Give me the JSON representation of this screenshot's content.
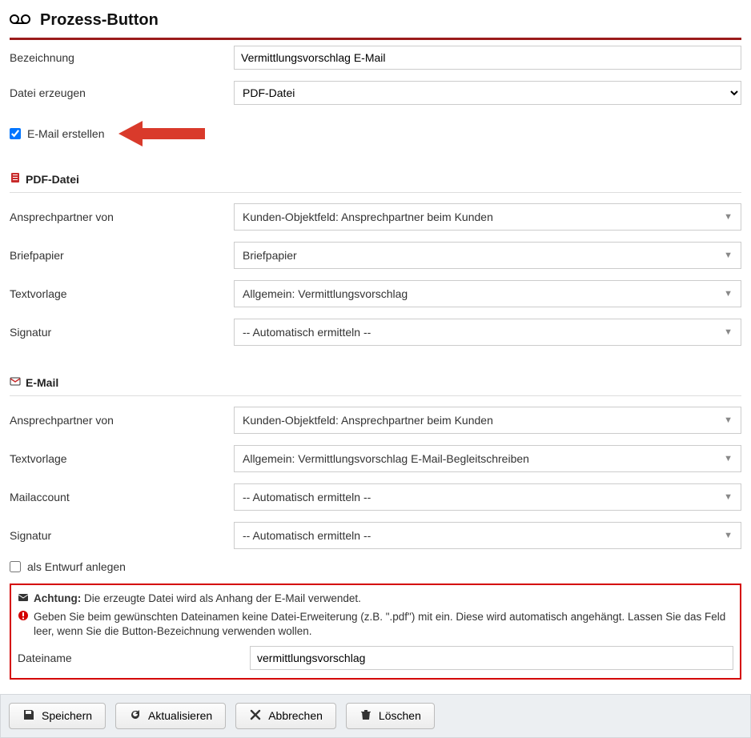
{
  "header": {
    "title": "Prozess-Button"
  },
  "form": {
    "bezeichnung_label": "Bezeichnung",
    "bezeichnung_value": "Vermittlungsvorschlag E-Mail",
    "datei_erzeugen_label": "Datei erzeugen",
    "datei_erzeugen_value": "PDF-Datei",
    "email_erstellen_label": "E-Mail erstellen"
  },
  "pdf_section": {
    "title": "PDF-Datei",
    "ansprechpartner_label": "Ansprechpartner von",
    "ansprechpartner_value": "Kunden-Objektfeld: Ansprechpartner beim Kunden",
    "briefpapier_label": "Briefpapier",
    "briefpapier_value": "Briefpapier",
    "textvorlage_label": "Textvorlage",
    "textvorlage_value": "Allgemein: Vermittlungsvorschlag",
    "signatur_label": "Signatur",
    "signatur_value": "-- Automatisch ermitteln --"
  },
  "email_section": {
    "title": "E-Mail",
    "ansprechpartner_label": "Ansprechpartner von",
    "ansprechpartner_value": "Kunden-Objektfeld: Ansprechpartner beim Kunden",
    "textvorlage_label": "Textvorlage",
    "textvorlage_value": "Allgemein: Vermittlungsvorschlag E-Mail-Begleitschreiben",
    "mailaccount_label": "Mailaccount",
    "mailaccount_value": "-- Automatisch ermitteln --",
    "signatur_label": "Signatur",
    "signatur_value": "-- Automatisch ermitteln --",
    "entwurf_label": "als Entwurf anlegen"
  },
  "callout": {
    "achtung_label": "Achtung:",
    "achtung_text": "Die erzeugte Datei wird als Anhang der E-Mail verwendet.",
    "warn_text": "Geben Sie beim gewünschten Dateinamen keine Datei-Erweiterung (z.B. \".pdf\") mit ein. Diese wird automatisch angehängt. Lassen Sie das Feld leer, wenn Sie die Button-Bezeichnung verwenden wollen.",
    "dateiname_label": "Dateiname",
    "dateiname_value": "vermittlungsvorschlag"
  },
  "buttons": {
    "speichern": "Speichern",
    "aktualisieren": "Aktualisieren",
    "abbrechen": "Abbrechen",
    "loeschen": "Löschen"
  }
}
